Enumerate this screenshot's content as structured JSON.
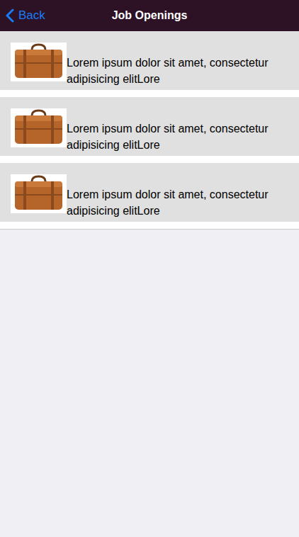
{
  "nav": {
    "back": "Back",
    "title": "Job Openings"
  },
  "jobs": [
    {
      "text": "Lorem ipsum dolor sit amet, consectetur adipisicing elitLore"
    },
    {
      "text": "Lorem ipsum dolor sit amet, consectetur adipisicing elitLore"
    },
    {
      "text": "Lorem ipsum dolor sit amet, consectetur adipisicing elitLore"
    }
  ]
}
